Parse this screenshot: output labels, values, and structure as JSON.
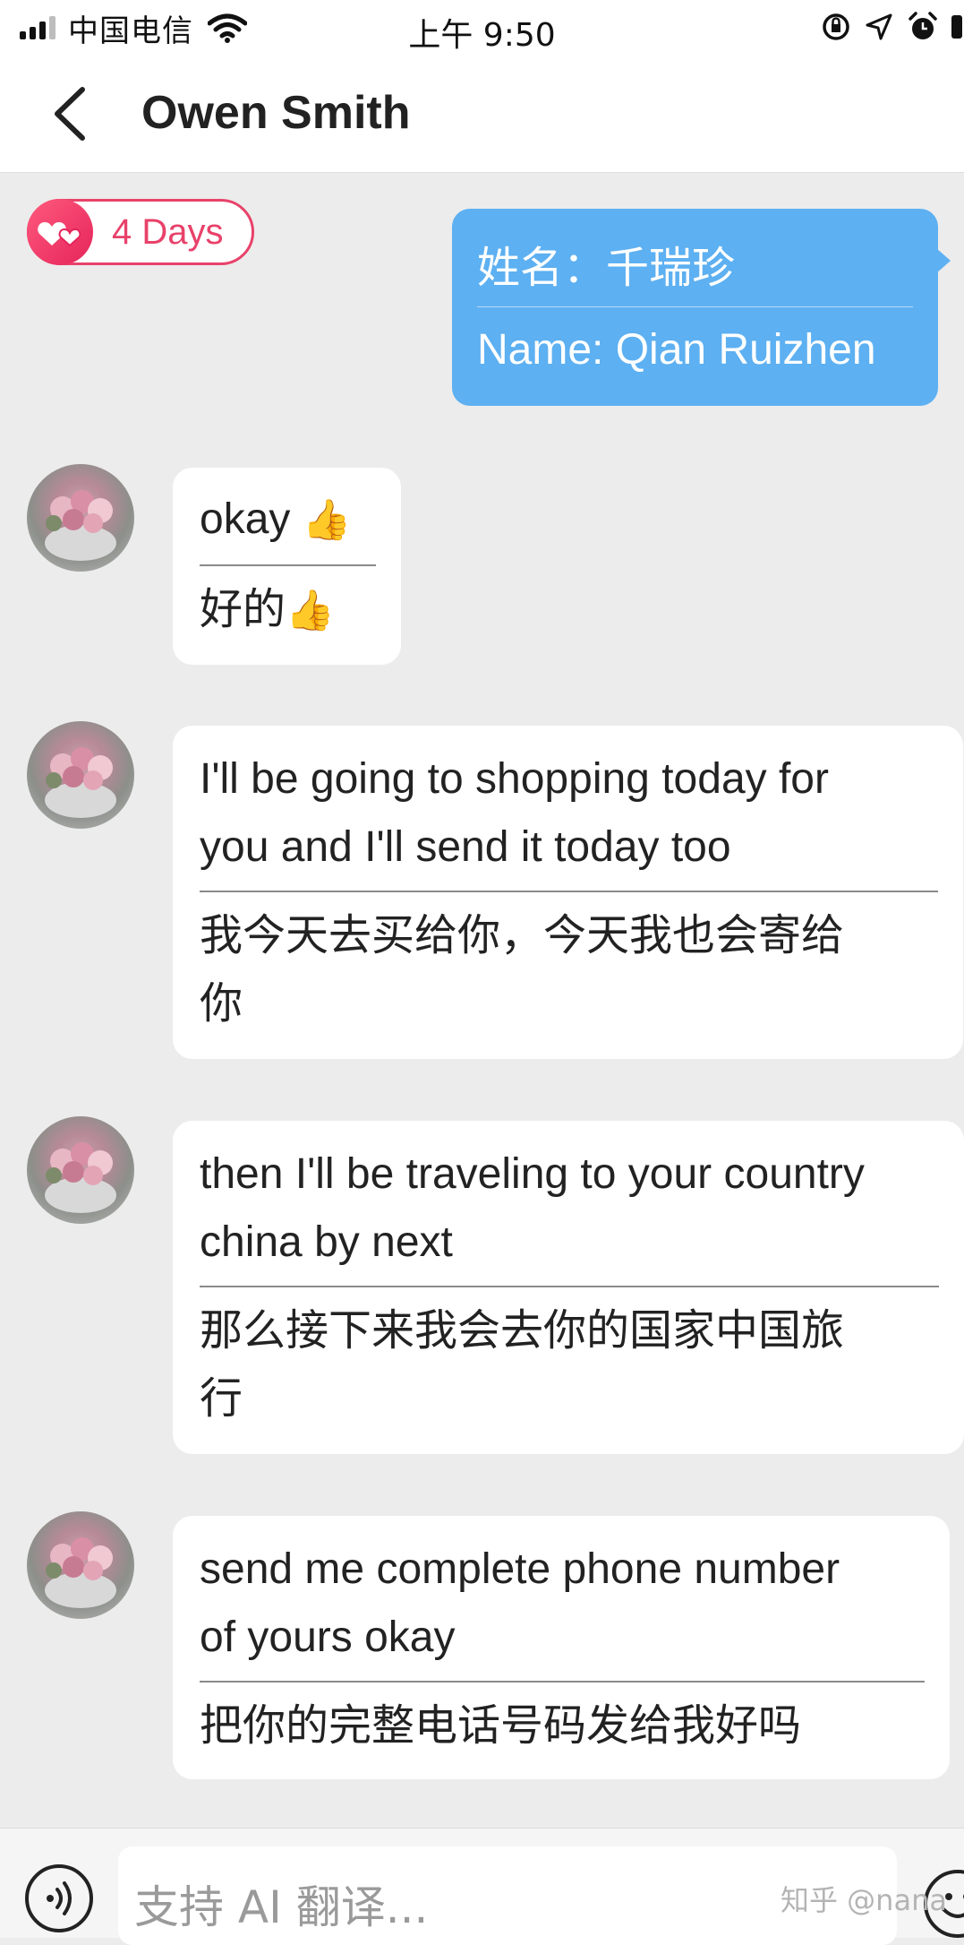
{
  "status_bar": {
    "carrier": "中国电信",
    "time": "上午 9:50"
  },
  "header": {
    "title": "Owen Smith"
  },
  "streak": {
    "label": "4 Days"
  },
  "outgoing": {
    "original": "姓名：千瑞珍",
    "translation": "Name: Qian Ruizhen"
  },
  "messages": [
    {
      "en": "okay",
      "zh": "好的"
    },
    {
      "en_1": "I'll be going to shopping today for",
      "en_2": "you and I'll send it today too",
      "zh_1": "我今天去买给你，今天我也会寄给",
      "zh_2": "你"
    },
    {
      "en_1": "then I'll be traveling to your country",
      "en_2": "china by next",
      "zh_1": "那么接下来我会去你的国家中国旅",
      "zh_2": "行"
    },
    {
      "en_1": "send me complete phone number",
      "en_2": "of yours okay",
      "zh_1": "把你的完整电话号码发给我好吗"
    }
  ],
  "input": {
    "placeholder": "支持 AI 翻译..."
  },
  "watermark": "知乎 @nana",
  "colors": {
    "outgoing_bubble": "#5db0f1",
    "streak_accent": "#e8426a",
    "background": "#ececec"
  }
}
